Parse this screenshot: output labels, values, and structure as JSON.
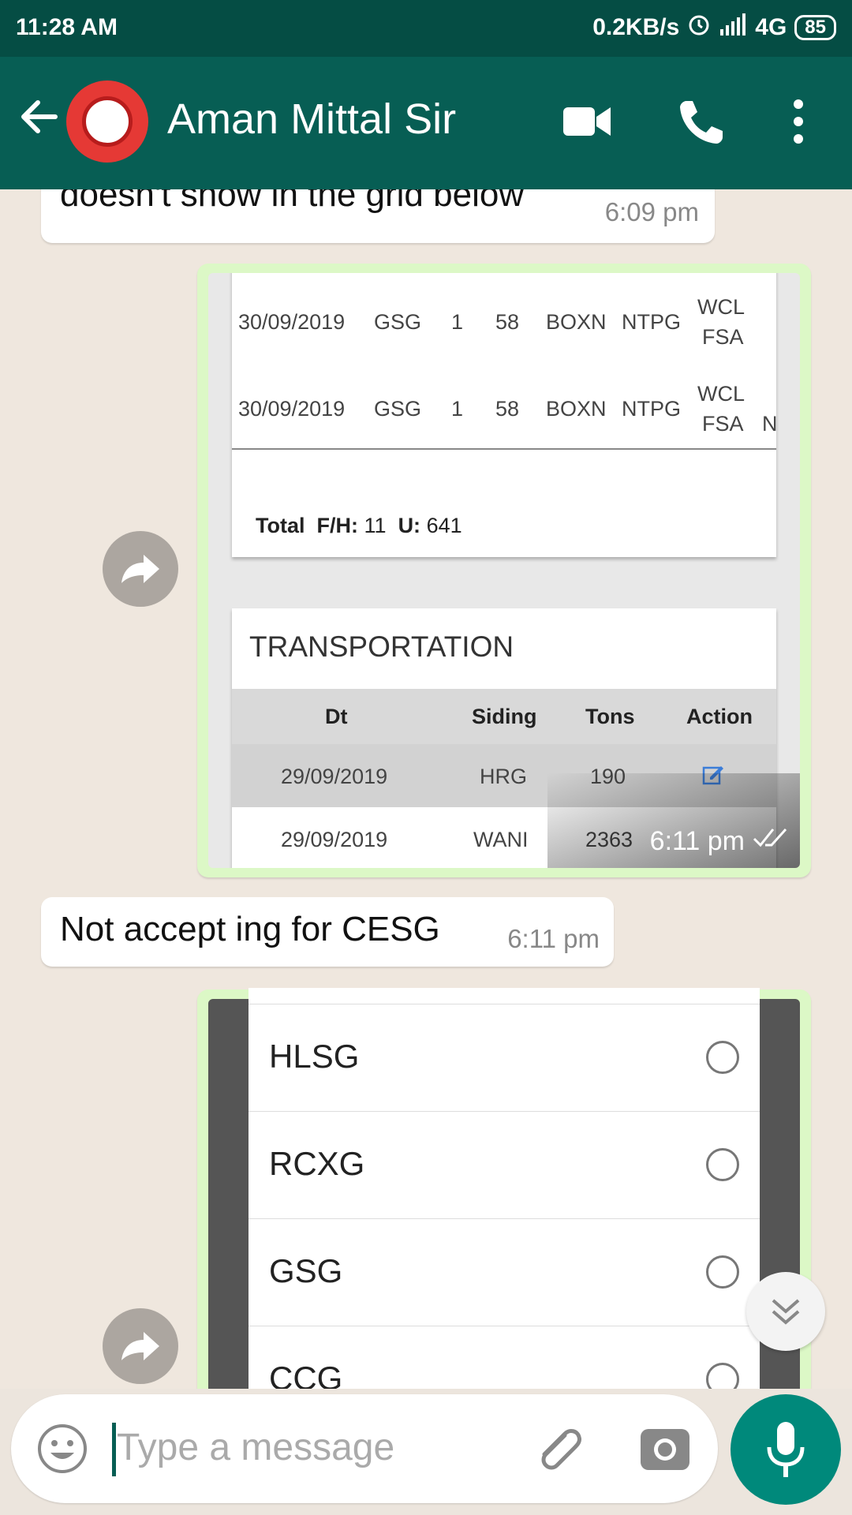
{
  "status_bar": {
    "time": "11:28 AM",
    "speed": "0.2KB/s",
    "network": "4G",
    "battery": "85"
  },
  "header": {
    "contact_name": "Aman Mittal Sir"
  },
  "messages": {
    "m1": {
      "text": "doesn't show in the grid below",
      "time": "6:09 pm"
    },
    "img1": {
      "rows": [
        [
          "30/09/2019",
          "GSG",
          "1",
          "58",
          "BOXN",
          "NTPG",
          "WCL",
          "FSA"
        ],
        [
          "30/09/2019",
          "GSG",
          "1",
          "58",
          "BOXN",
          "NTPG",
          "WCL",
          "FSA"
        ]
      ],
      "row2_extra": "N",
      "total_label": "Total",
      "fh_label": "F/H:",
      "fh_value": "11",
      "u_label": "U:",
      "u_value": "641",
      "section_title": "TRANSPORTATION",
      "columns": [
        "Dt",
        "Siding",
        "Tons",
        "Action"
      ],
      "trows": [
        [
          "29/09/2019",
          "HRG",
          "190"
        ],
        [
          "29/09/2019",
          "WANI",
          "2363"
        ]
      ],
      "time": "6:11 pm"
    },
    "m2": {
      "text": "Not accept ing for CESG",
      "time": "6:11 pm"
    },
    "img2": {
      "options": [
        "HLSG",
        "RCXG",
        "GSG",
        "CCG"
      ]
    }
  },
  "composer": {
    "placeholder": "Type a message"
  },
  "colors": {
    "header": "#075e54",
    "status": "#054d44",
    "bubble_out": "#dcf8c6",
    "accent": "#00897b"
  }
}
